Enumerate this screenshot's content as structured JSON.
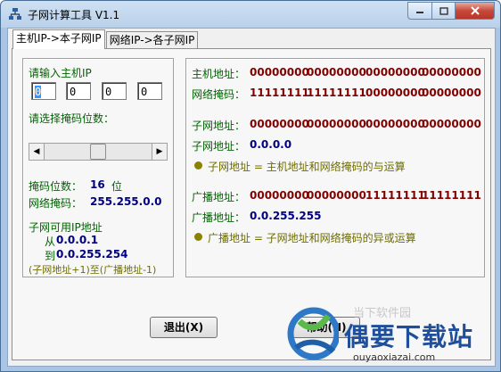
{
  "window": {
    "title": "子网计算工具  V1.1"
  },
  "tabs": [
    "主机IP->本子网IP",
    "网络IP->各子网IP"
  ],
  "left": {
    "host_ip_label": "请输入主机IP",
    "ip_octets": [
      "0",
      "0",
      "0",
      "0"
    ],
    "mask_bits_prompt": "请选择掩码位数：",
    "mask_bits_label": "掩码位数：",
    "mask_bits_value": "16",
    "mask_bits_unit": "位",
    "netmask_label": "网络掩码：",
    "netmask_value": "255.255.0.0",
    "usable_title": "子网可用IP地址",
    "from_label": "从",
    "from_value": "0.0.0.1",
    "to_label": "到",
    "to_value": "0.0.255.254",
    "range_note": "(子网地址+1)至(广播地址-1)",
    "slider_fraction": 0.5
  },
  "right": {
    "host_addr_label": "主机地址：",
    "host_addr_bits": [
      "00000000",
      "00000000",
      "00000000",
      "00000000"
    ],
    "netmask_label": "网络掩码：",
    "netmask_bits": [
      "11111111",
      "11111111",
      "00000000",
      "00000000"
    ],
    "subnet_addr_label": "子网地址：",
    "subnet_addr_bits": [
      "00000000",
      "00000000",
      "00000000",
      "00000000"
    ],
    "subnet_label": "子网地址：",
    "subnet_value": "0.0.0.0",
    "subnet_note": "子网地址 = 主机地址和网络掩码的与运算",
    "broadcast_addr_label": "广播地址：",
    "broadcast_bits": [
      "00000000",
      "00000000",
      "11111111",
      "11111111"
    ],
    "broadcast_label": "广播地址：",
    "broadcast_value": "0.0.255.255",
    "broadcast_note": "广播地址 = 子网地址和网络掩码的异或运算"
  },
  "buttons": {
    "exit": "退出(X)",
    "help": "帮助(H)"
  },
  "watermark": {
    "brand": "偶要下载站",
    "url": "ouyaoxiazai.com",
    "faint": "当下软件园"
  }
}
